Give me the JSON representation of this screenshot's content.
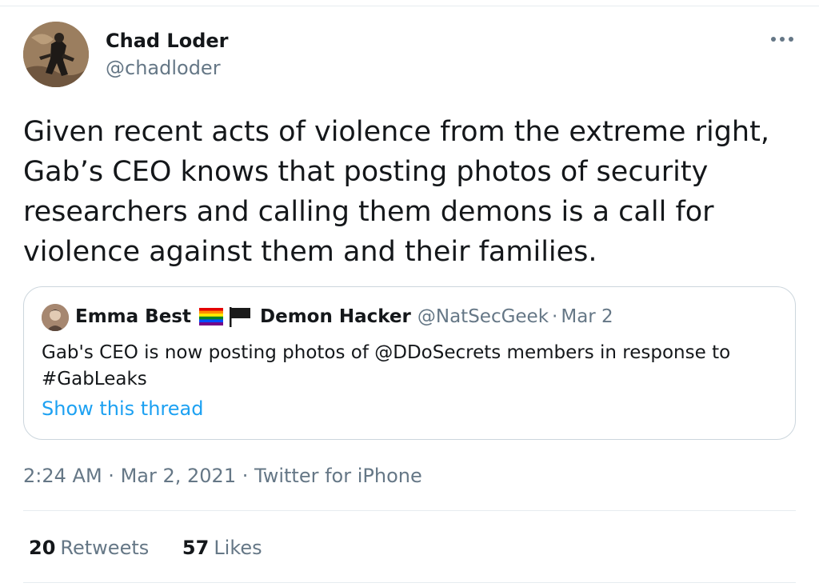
{
  "tweet": {
    "author": {
      "name": "Chad Loder",
      "handle": "@chadloder"
    },
    "text": "Given recent acts of violence from the extreme right,\nGab’s CEO knows that posting photos of security\nresearchers and calling them demons is a call for\nviolence against them and their families.",
    "more_icon": "more-horizontal-icon",
    "quoted": {
      "author_name_part1": "Emma Best",
      "author_name_part2": "Demon Hacker",
      "flags": [
        "rainbow-flag-icon",
        "black-flag-icon"
      ],
      "handle": "@NatSecGeek",
      "separator": "·",
      "date": "Mar 2",
      "text": "Gab's CEO is now posting photos of @DDoSecrets members in response to\n#GabLeaks",
      "show_thread": "Show this thread"
    },
    "meta": {
      "time": "2:24 AM",
      "separator": "·",
      "date": "Mar 2, 2021",
      "source": "Twitter for iPhone"
    },
    "stats": {
      "retweets_count": "20",
      "retweets_label": "Retweets",
      "likes_count": "57",
      "likes_label": "Likes"
    }
  },
  "colors": {
    "text_primary": "#14171a",
    "text_secondary": "#657786",
    "link": "#1da1f2",
    "border": "#ccd6dd",
    "divider": "#e6ecf0"
  }
}
